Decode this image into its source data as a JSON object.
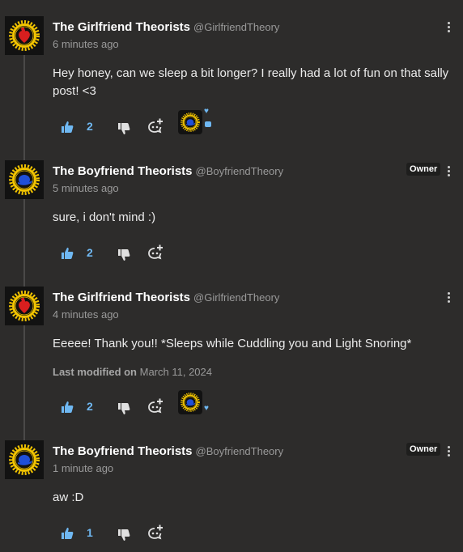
{
  "colors": {
    "background": "#2d2c2b",
    "accent": "#6fb8f2",
    "text": "#e8e8e8",
    "muted": "#9a9a9a"
  },
  "comments": [
    {
      "author": "The Girlfriend Theorists",
      "handle": "@GirlfriendTheory",
      "time": "6 minutes ago",
      "text": "Hey honey, can we sleep a bit longer? I really had a lot of fun on that sally post! <3",
      "likes": "2",
      "owner": false,
      "avatar": "red-heart-avatar"
    },
    {
      "author": "The Boyfriend Theorists",
      "handle": "@BoyfriendTheory",
      "time": "5 minutes ago",
      "text": "sure, i don't mind :)",
      "likes": "2",
      "owner": true,
      "badge": "Owner",
      "avatar": "blue-hat-avatar"
    },
    {
      "author": "The Girlfriend Theorists",
      "handle": "@GirlfriendTheory",
      "time": "4 minutes ago",
      "text": "Eeeee! Thank you!! *Sleeps while Cuddling you and Light Snoring*",
      "modified_label": "Last modified on",
      "modified_date": "March 11, 2024",
      "likes": "2",
      "owner": false,
      "avatar": "red-heart-avatar"
    },
    {
      "author": "The Boyfriend Theorists",
      "handle": "@BoyfriendTheory",
      "time": "1 minute ago",
      "text": "aw :D",
      "likes": "1",
      "owner": true,
      "badge": "Owner",
      "avatar": "blue-hat-avatar"
    }
  ],
  "icons": {
    "like": "thumbs-up-icon",
    "dislike": "thumbs-down-icon",
    "reply": "reply-icon",
    "more": "more-vertical-icon",
    "heart": "heart-icon"
  }
}
